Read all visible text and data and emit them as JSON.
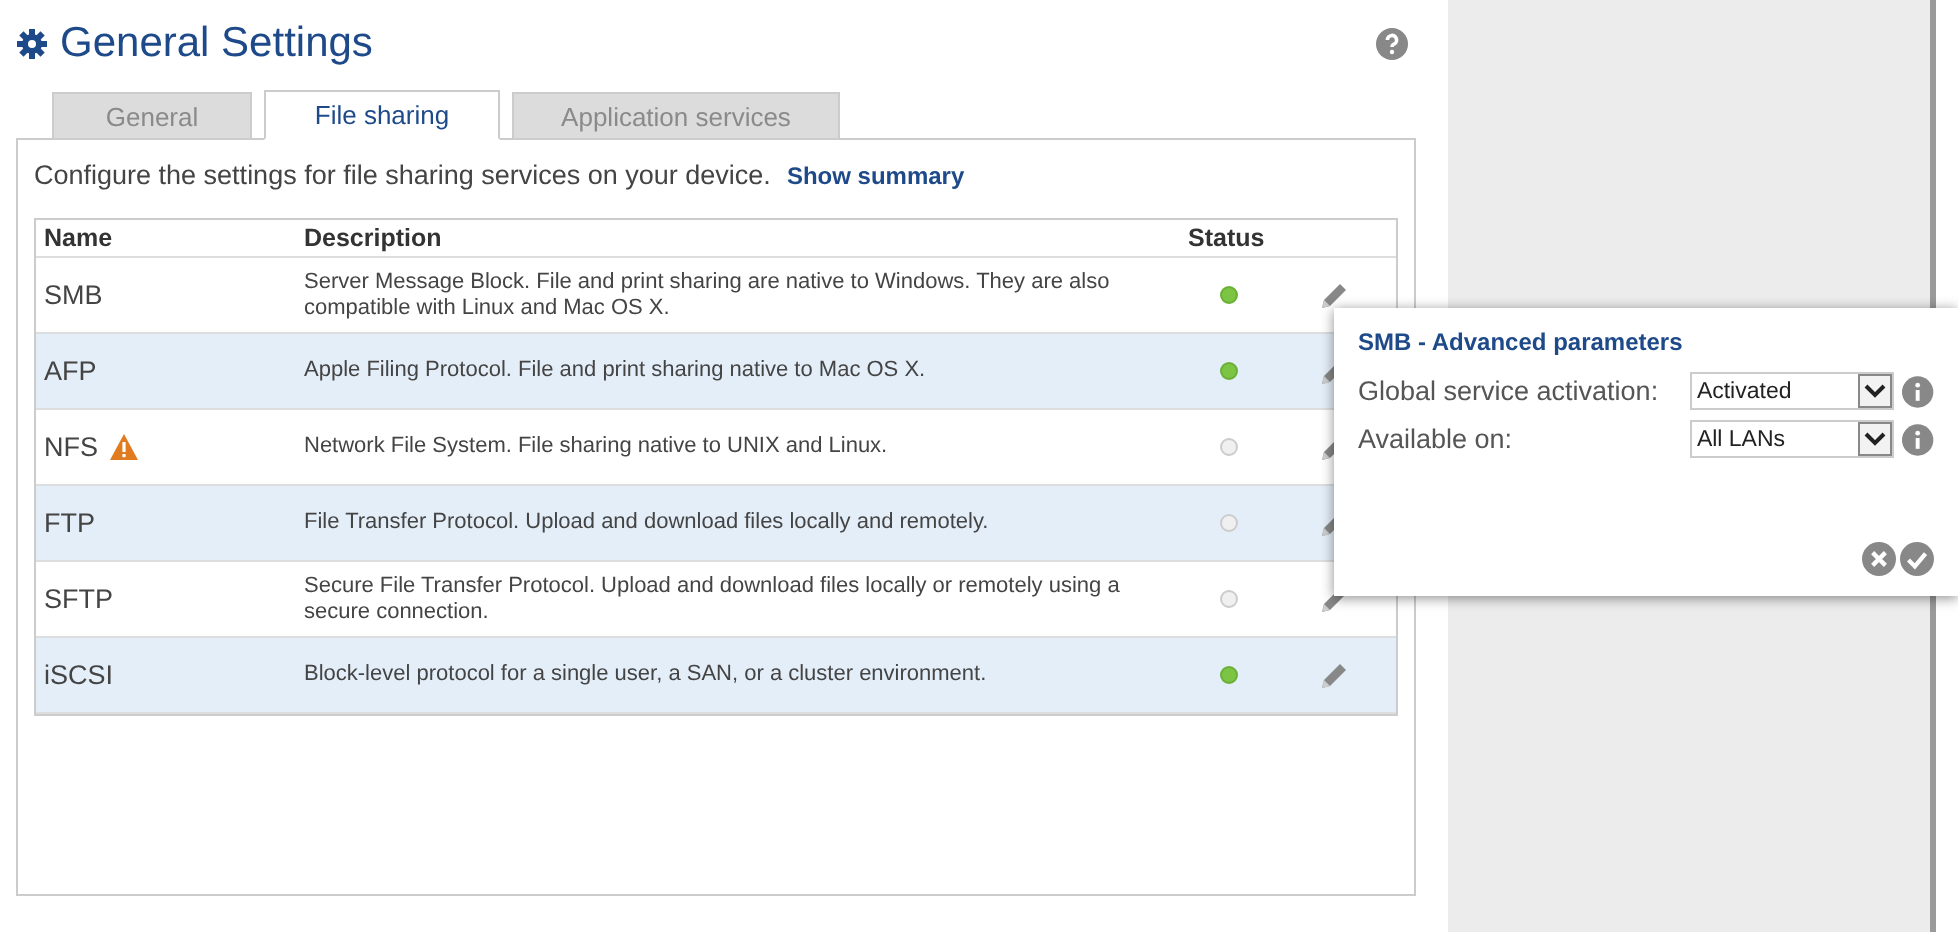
{
  "page": {
    "title": "General Settings"
  },
  "tabs": [
    {
      "label": "General",
      "selected": false
    },
    {
      "label": "File sharing",
      "selected": true
    },
    {
      "label": "Application services",
      "selected": false
    }
  ],
  "intro": {
    "text": "Configure the settings for file sharing services on your device.",
    "link": "Show summary"
  },
  "table": {
    "columns": [
      "Name",
      "Description",
      "Status"
    ],
    "rows": [
      {
        "name": "SMB",
        "warning": false,
        "description": "Server Message Block. File and print sharing are native to Windows. They are also compatible with Linux and Mac OS X.",
        "active": true
      },
      {
        "name": "AFP",
        "warning": false,
        "description": "Apple Filing Protocol. File and print sharing native to Mac OS X.",
        "active": true
      },
      {
        "name": "NFS",
        "warning": true,
        "description": "Network File System. File sharing native to UNIX and Linux.",
        "active": false
      },
      {
        "name": "FTP",
        "warning": false,
        "description": "File Transfer Protocol. Upload and download files locally and remotely.",
        "active": false
      },
      {
        "name": "SFTP",
        "warning": false,
        "description": "Secure File Transfer Protocol. Upload and download files locally or remotely using a secure connection.",
        "active": false
      },
      {
        "name": "iSCSI",
        "warning": false,
        "description": "Block-level protocol for a single user, a SAN, or a cluster environment.",
        "active": true
      }
    ]
  },
  "popup": {
    "title": "SMB - Advanced parameters",
    "fields": [
      {
        "label": "Global service activation:",
        "value": "Activated"
      },
      {
        "label": "Available on:",
        "value": "All LANs"
      }
    ]
  }
}
